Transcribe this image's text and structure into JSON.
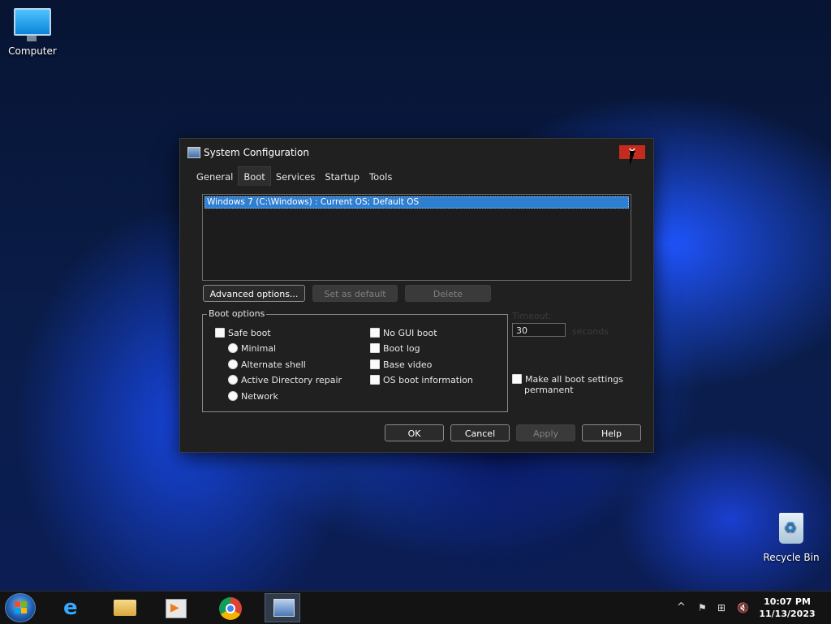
{
  "desktop": {
    "icons": [
      {
        "label": "Computer"
      },
      {
        "label": "Recycle Bin"
      }
    ]
  },
  "dialog": {
    "title": "System Configuration",
    "close_glyph": "✕",
    "tabs": [
      {
        "label": "General",
        "active": false
      },
      {
        "label": "Boot",
        "active": true
      },
      {
        "label": "Services",
        "active": false
      },
      {
        "label": "Startup",
        "active": false
      },
      {
        "label": "Tools",
        "active": false
      }
    ],
    "os_entries": [
      "Windows 7 (C:\\Windows) : Current OS; Default OS"
    ],
    "buttons": {
      "advanced": "Advanced options...",
      "set_default": "Set as default",
      "delete": "Delete"
    },
    "boot_options": {
      "label": "Boot options",
      "safe_boot": {
        "label": "Safe boot",
        "checked": false
      },
      "minimal": {
        "label": "Minimal",
        "selected": false
      },
      "alternate_shell": {
        "label": "Alternate shell",
        "selected": false
      },
      "ad_repair": {
        "label": "Active Directory repair",
        "selected": false
      },
      "network": {
        "label": "Network",
        "selected": false
      },
      "no_gui": {
        "label": "No GUI boot",
        "checked": false
      },
      "boot_log": {
        "label": "Boot log",
        "checked": false
      },
      "base_video": {
        "label": "Base video",
        "checked": false
      },
      "os_boot_info": {
        "label": "OS boot information",
        "checked": false
      }
    },
    "timeout": {
      "label": "Timeout:",
      "value": "30",
      "unit": "seconds"
    },
    "make_permanent": {
      "label_line1": "Make all boot settings",
      "label_line2": "permanent",
      "checked": false
    },
    "footer": {
      "ok": "OK",
      "cancel": "Cancel",
      "apply": "Apply",
      "help": "Help"
    }
  },
  "taskbar": {
    "items": [
      {
        "icon": "internet-explorer-icon"
      },
      {
        "icon": "file-explorer-icon"
      },
      {
        "icon": "media-player-icon"
      },
      {
        "icon": "chrome-icon"
      },
      {
        "icon": "system-configuration-icon",
        "active": true
      }
    ],
    "tray": {
      "chevron": "^",
      "time": "10:07 PM",
      "date": "11/13/2023"
    }
  },
  "colors": {
    "accent_selection": "#2f7fd1",
    "close_red": "#c42b1c",
    "dialog_bg": "#202020"
  }
}
